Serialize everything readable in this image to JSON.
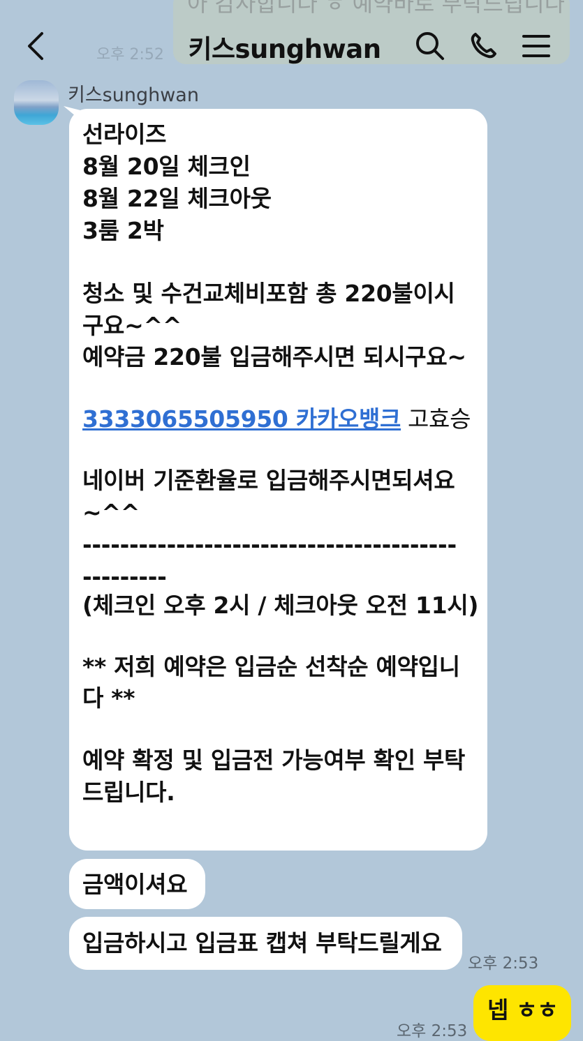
{
  "background_message": {
    "text": "아 감사합니다 ㅎ 예약바로 부탁드립니다",
    "time": "오후 2:52"
  },
  "header": {
    "title": "키스sunghwan"
  },
  "sender": {
    "name": "키스sunghwan"
  },
  "message_1": {
    "lines": [
      "선라이즈",
      "8월 20일 체크인",
      "8월 22일 체크아웃",
      "3룸 2박",
      "청소 및 수건교체비포함 총 220불이시",
      "구요~^^",
      "예약금 220불 입금해주시면 되시구요~",
      "3333065505950 카카오뱅크",
      "고효승",
      "네이버 기준환율로 입금해주시면되셔요",
      "~^^",
      "----------------------------------------",
      "---------",
      "(체크인 오후 2시 / 체크아웃 오전 11시)",
      "** 저희 예약은 입금순 선착순 예약입니",
      "다 **",
      "예약 확정 및 입금전 가능여부 확인 부탁",
      "드립니다."
    ]
  },
  "message_2": {
    "text": "금액이셔요"
  },
  "message_3": {
    "text": "입금하시고 입금표 캡쳐 부탁드릴게요",
    "time": "오후 2:53"
  },
  "my_message": {
    "text": "넵 ㅎㅎ",
    "time": "오후 2:53"
  },
  "colors": {
    "chat_background": "#b2c7d9",
    "incoming_bubble": "#ffffff",
    "outgoing_bubble": "#fee500",
    "link": "#2f6fd3"
  },
  "icons": {
    "back": "chevron-left-icon",
    "search": "search-icon",
    "call": "phone-icon",
    "menu": "menu-icon"
  }
}
